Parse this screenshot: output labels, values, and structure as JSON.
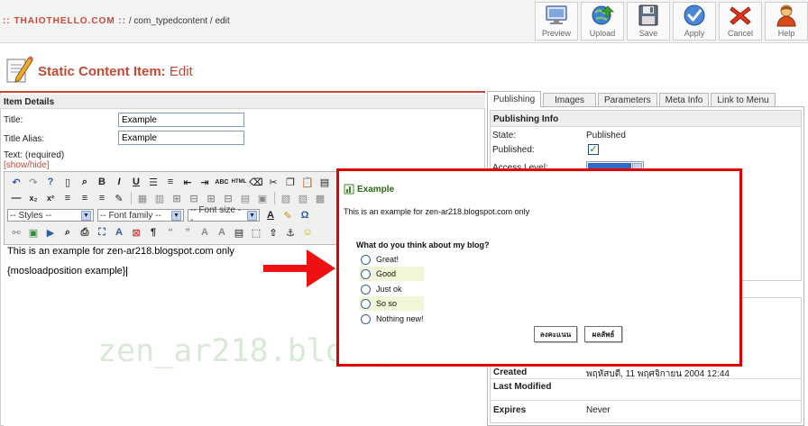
{
  "header": {
    "site": ":: THAIOTHELLO.COM ::",
    "path": "/ com_typedcontent / edit"
  },
  "toolbar": {
    "preview": "Preview",
    "upload": "Upload",
    "save": "Save",
    "apply": "Apply",
    "cancel": "Cancel",
    "help": "Help"
  },
  "page": {
    "title": "Static Content Item:",
    "mode": "Edit"
  },
  "item_details": {
    "heading": "Item Details",
    "title_label": "Title:",
    "title_value": "Example",
    "alias_label": "Title Alias:",
    "alias_value": "Example",
    "text_label": "Text: (required)",
    "show_hide": "[show/hide]"
  },
  "editor": {
    "styles_select": "-- Styles --",
    "font_family_select": "-- Font family --",
    "font_size_select": "-- Font size --",
    "content_lines": [
      "This is an example for zen-ar218.blogspot.com only",
      "{mosloadposition example}"
    ]
  },
  "tabs": [
    "Publishing",
    "Images",
    "Parameters",
    "Meta Info",
    "Link to Menu"
  ],
  "publishing": {
    "heading": "Publishing Info",
    "state_label": "State:",
    "state_value": "Published",
    "published_label": "Published:",
    "published_checked": true,
    "access_label": "Access Level:"
  },
  "meta": {
    "created_label": "Created",
    "created_value": "พฤหัสบดี, 11 พฤศจิกายน 2004 12:44",
    "modified_label": "Last Modified",
    "expires_label": "Expires",
    "expires_value": "Never"
  },
  "watermark": "zen_ar218.blogspot.com",
  "popup": {
    "title": "Example",
    "text": "This is an example for zen-ar218.blogspot.com only",
    "poll_question": "What do you think about my blog?",
    "poll_options": [
      "Great!",
      "Good",
      "Just ok",
      "So so",
      "Nothing new!"
    ],
    "vote_button": "ลงคะแนน",
    "results_button": "ผลลัพธ์"
  },
  "colors": {
    "brand_red": "#c64934",
    "popup_border": "#e00000",
    "arrow": "#ee1111",
    "popup_title_green": "#2a6a13",
    "poll_alt_row": "#f1f6d6"
  },
  "icons": {
    "preview": "monitor-icon",
    "upload": "globe-upload-icon",
    "save": "floppy-disk-icon",
    "apply": "checkmark-icon",
    "cancel": "red-x-icon",
    "help": "person-help-icon",
    "heading": "pencil-document-icon",
    "popup": "poll-icon"
  }
}
